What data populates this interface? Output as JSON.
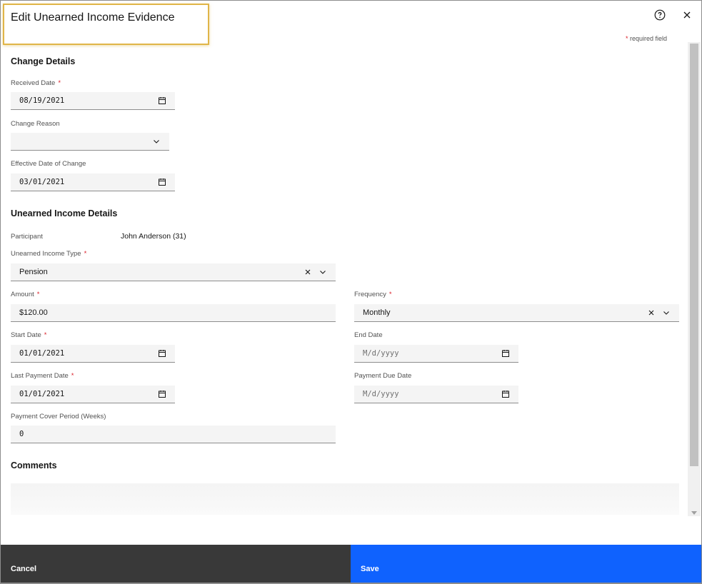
{
  "dialog": {
    "title": "Edit Unearned Income Evidence",
    "required_note_star": "*",
    "required_note": "required field"
  },
  "change_details": {
    "heading": "Change Details",
    "received_date": {
      "label": "Received Date",
      "value": "08/19/2021"
    },
    "change_reason": {
      "label": "Change Reason",
      "value": ""
    },
    "effective_date": {
      "label": "Effective Date of Change",
      "value": "03/01/2021"
    }
  },
  "unearned_income_details": {
    "heading": "Unearned Income Details",
    "participant": {
      "label": "Participant",
      "value": "John Anderson (31)"
    },
    "income_type": {
      "label": "Unearned Income Type",
      "value": "Pension"
    },
    "amount": {
      "label": "Amount",
      "value": "$120.00"
    },
    "frequency": {
      "label": "Frequency",
      "value": "Monthly"
    },
    "start_date": {
      "label": "Start Date",
      "value": "01/01/2021"
    },
    "end_date": {
      "label": "End Date",
      "placeholder": "M/d/yyyy"
    },
    "last_payment_date": {
      "label": "Last Payment Date",
      "value": "01/01/2021"
    },
    "payment_due_date": {
      "label": "Payment Due Date",
      "placeholder": "M/d/yyyy"
    },
    "payment_cover_period": {
      "label": "Payment Cover Period (Weeks)",
      "value": "0"
    }
  },
  "comments": {
    "heading": "Comments"
  },
  "footer": {
    "cancel_label": "Cancel",
    "save_label": "Save"
  },
  "icons": {
    "help": "help-circle-icon",
    "close": "close-icon",
    "calendar": "calendar-icon",
    "chevron": "chevron-down-icon",
    "clear": "clear-x-icon"
  },
  "colors": {
    "primary": "#0f62fe",
    "secondary": "#393939",
    "required": "#da1e28",
    "highlight": "#e0b548",
    "field_bg": "#f4f4f4"
  }
}
